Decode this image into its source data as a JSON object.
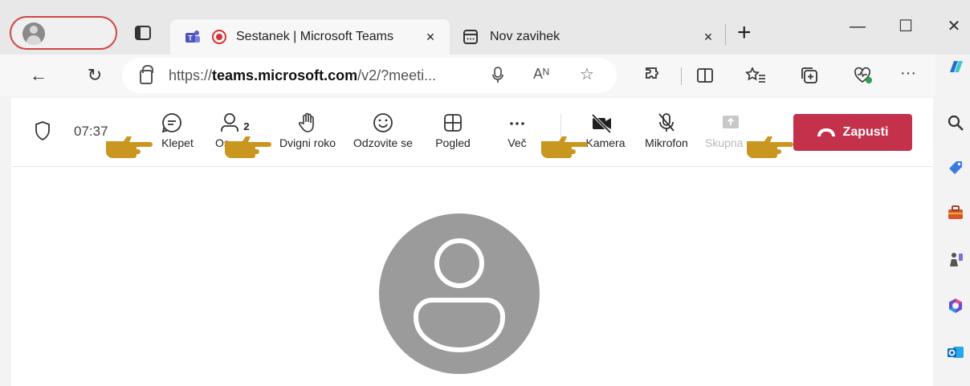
{
  "browser": {
    "tabs": [
      {
        "title": "Sestanek | Microsoft Teams",
        "close": "×",
        "active": true
      },
      {
        "title": "Nov zavihek",
        "close": "×",
        "active": false
      }
    ],
    "new_tab": "+",
    "window": {
      "minimize": "—",
      "maximize": "☐",
      "close": "✕"
    }
  },
  "address_bar": {
    "url_prefix": "https://",
    "url_domain": "teams.microsoft.com",
    "url_rest": "/v2/?meeti...",
    "back": "←",
    "refresh": "↻"
  },
  "toolbar_icons": {
    "read_aloud": "Aᴺ",
    "favorite": "☆",
    "more": "···"
  },
  "meeting": {
    "timer": "07:37",
    "participants_count": "2",
    "buttons": [
      {
        "label": "Klepet",
        "icon": "chat-icon"
      },
      {
        "label": "Os",
        "icon": "people-icon"
      },
      {
        "label": "Dvigni roko",
        "icon": "raise-hand-icon"
      },
      {
        "label": "Odzovite se",
        "icon": "emoji-icon"
      },
      {
        "label": "Pogled",
        "icon": "grid-view-icon"
      },
      {
        "label": "Več",
        "icon": "more-icon"
      },
      {
        "label": "Kamera",
        "icon": "camera-off-icon"
      },
      {
        "label": "Mikrofon",
        "icon": "mic-off-icon"
      },
      {
        "label": "Skupna",
        "icon": "share-icon"
      }
    ],
    "leave_label": "Zapusti"
  },
  "colors": {
    "leave_red": "#c4314b",
    "pointer_gold": "#c9961f",
    "avatar_gray": "#9b9b9b"
  }
}
